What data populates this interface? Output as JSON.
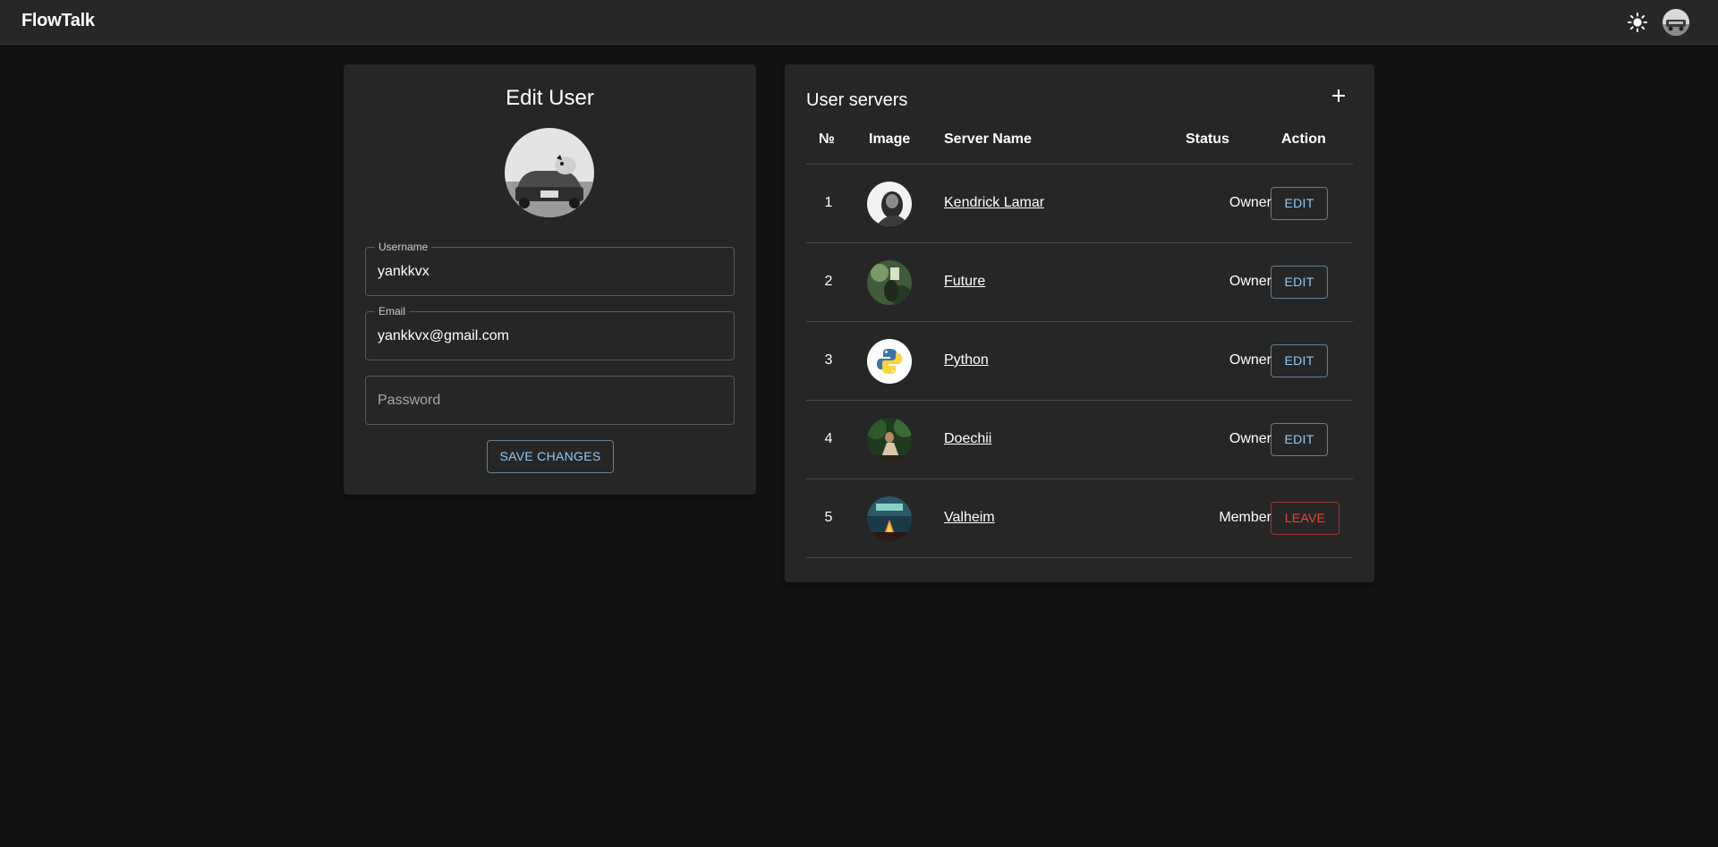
{
  "appbar": {
    "brand": "FlowTalk",
    "theme_icon": "sun-icon",
    "avatar_icon": "user-avatar"
  },
  "edit_user": {
    "title": "Edit User",
    "username_label": "Username",
    "username_value": "yankkvx",
    "email_label": "Email",
    "email_value": "yankkvx@gmail.com",
    "password_placeholder": "Password",
    "save_label": "SAVE CHANGES"
  },
  "servers": {
    "title": "User servers",
    "add_icon": "plus-icon",
    "headers": {
      "num": "№",
      "image": "Image",
      "name": "Server Name",
      "status": "Status",
      "action": "Action"
    },
    "rows": [
      {
        "num": "1",
        "name": "Kendrick Lamar",
        "status": "Owner",
        "action": "EDIT"
      },
      {
        "num": "2",
        "name": "Future",
        "status": "Owner",
        "action": "EDIT"
      },
      {
        "num": "3",
        "name": "Python",
        "status": "Owner",
        "action": "EDIT"
      },
      {
        "num": "4",
        "name": "Doechii",
        "status": "Owner",
        "action": "EDIT"
      },
      {
        "num": "5",
        "name": "Valheim",
        "status": "Member",
        "action": "LEAVE"
      }
    ]
  },
  "colors": {
    "background": "#121212",
    "surface": "#262626",
    "primary": "#90caf9",
    "danger": "#f44336"
  }
}
